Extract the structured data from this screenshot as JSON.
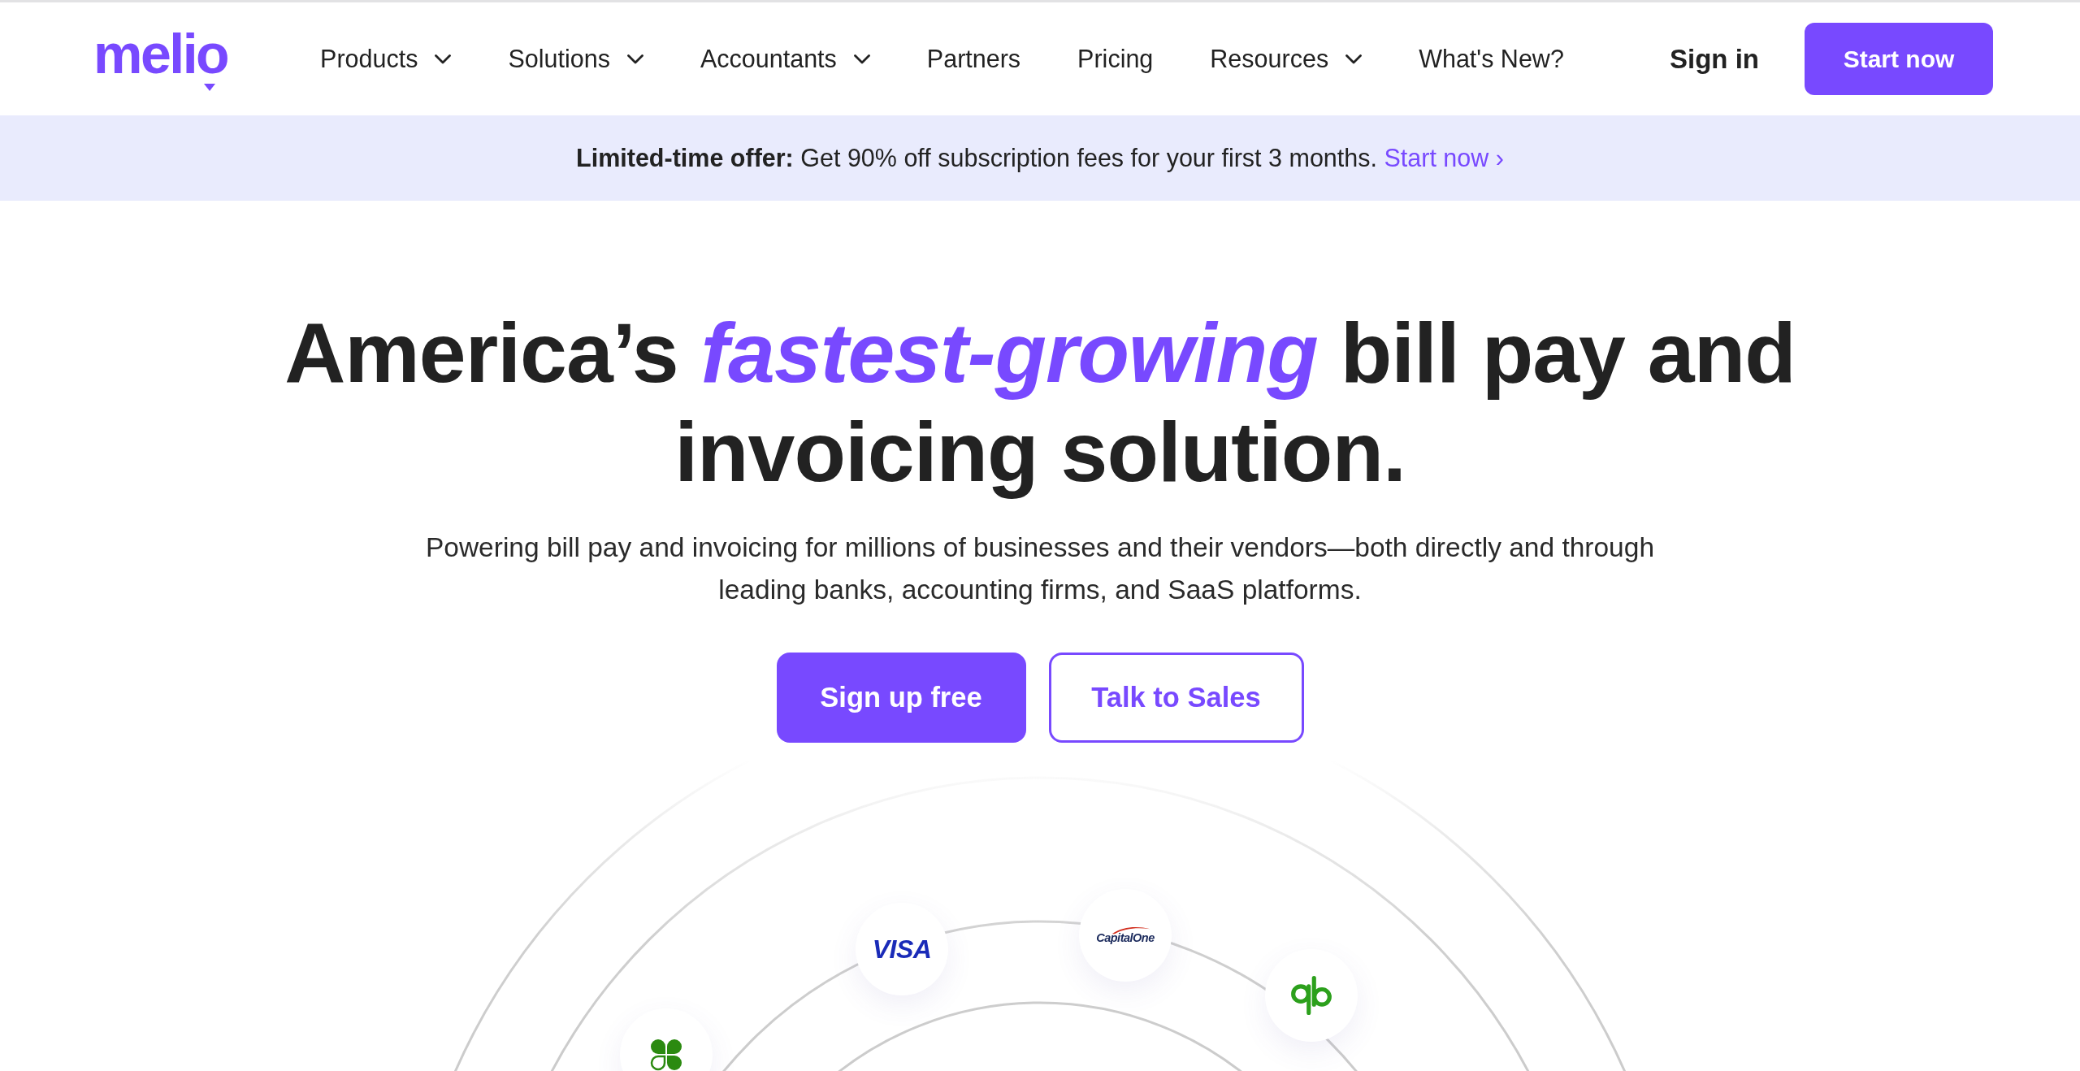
{
  "top_nav": {
    "logo": "melio",
    "items": [
      {
        "label": "Products",
        "dropdown": true
      },
      {
        "label": "Solutions",
        "dropdown": true
      },
      {
        "label": "Accountants",
        "dropdown": true
      },
      {
        "label": "Partners",
        "dropdown": false
      },
      {
        "label": "Pricing",
        "dropdown": false
      },
      {
        "label": "Resources",
        "dropdown": true
      },
      {
        "label": "What's New?",
        "dropdown": false
      }
    ],
    "sign_in": "Sign in",
    "cta": "Start now"
  },
  "promo_banner": {
    "text": "**Limited-time offer:** Get 90% off subscription fees for your first 3 months.",
    "link": "Start now ›"
  },
  "hero": {
    "heading": "America’s *fastest-growing* bill pay and invoicing solution.",
    "subheading": "Powering bill pay and invoicing for millions of businesses and their vendors—both directly and through leading banks, accounting firms, and SaaS platforms.",
    "buttons": [
      {
        "label": "Sign up free",
        "kind": "primary"
      },
      {
        "label": "Talk to Sales",
        "kind": "outline"
      }
    ]
  },
  "partner_logos": [
    {
      "kind": "wordmark",
      "text": "VISA"
    },
    {
      "kind": "swoosh",
      "text": "CapitalOne"
    },
    {
      "kind": "loops"
    },
    {
      "kind": "clover"
    }
  ]
}
